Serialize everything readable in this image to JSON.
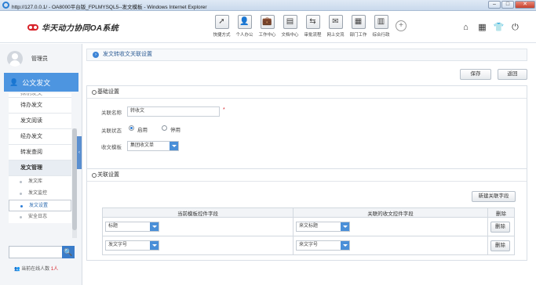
{
  "browser": {
    "title": "http://127.0.0.1/ - OA8000平台版_FPLMYSQL5--发文模板 - Windows Internet Explorer",
    "minimize": "–",
    "maximize": "□",
    "close": "✕"
  },
  "app": {
    "logo_text": "华天动力协同OA系统"
  },
  "topnav": [
    {
      "label": "快捷方式",
      "icon": "arrow-cursor-icon",
      "glyph": "➚"
    },
    {
      "label": "个人办公",
      "icon": "person-icon",
      "glyph": "👤"
    },
    {
      "label": "工作中心",
      "icon": "briefcase-icon",
      "glyph": "💼"
    },
    {
      "label": "文档中心",
      "icon": "folder-icon",
      "glyph": "▤"
    },
    {
      "label": "审批流程",
      "icon": "flow-icon",
      "glyph": "⇆"
    },
    {
      "label": "网上交流",
      "icon": "chat-icon",
      "glyph": "✉"
    },
    {
      "label": "部门工作",
      "icon": "department-icon",
      "glyph": "▦"
    },
    {
      "label": "综合行政",
      "icon": "trash-admin-icon",
      "glyph": "▥"
    }
  ],
  "topnav_more": "+",
  "header_icons": [
    {
      "name": "home-icon",
      "glyph": "⌂"
    },
    {
      "name": "grid-icon",
      "glyph": "▦"
    },
    {
      "name": "shirt-icon",
      "glyph": "👕"
    },
    {
      "name": "power-icon",
      "glyph": "⏻"
    }
  ],
  "sidebar": {
    "user": "管理员",
    "module": "公文发文",
    "module_icon": "person-icon",
    "items": [
      {
        "label": "拟制发文",
        "state": "cut"
      },
      {
        "label": "待办发文",
        "state": "normal"
      },
      {
        "label": "发文阅读",
        "state": "normal"
      },
      {
        "label": "经办发文",
        "state": "normal"
      },
      {
        "label": "转发查阅",
        "state": "normal"
      },
      {
        "label": "发文管理",
        "state": "active"
      }
    ],
    "subitems": [
      {
        "label": "发文库",
        "selected": false
      },
      {
        "label": "发文监控",
        "selected": false
      },
      {
        "label": "发文设置",
        "selected": true
      },
      {
        "label": "安全日志",
        "selected": false
      }
    ],
    "collapse_glyph": "‹",
    "search_icon": "🔍",
    "online_text": "当前在线人数",
    "online_count": "1人"
  },
  "main": {
    "breadcrumb": "发文转收文关联设置",
    "save_label": "保存",
    "back_label": "返回",
    "basic": {
      "title": "基础设置",
      "name_label": "关联名称",
      "name_value": "转收文",
      "required_mark": "*",
      "status_label": "关联状态",
      "status_on": "启用",
      "status_off": "停用",
      "status_value": "启用",
      "template_label": "收文模板",
      "template_value": "集团收文单"
    },
    "relation": {
      "title": "关联设置",
      "add_label": "新建关联字段",
      "columns": [
        "当前模板控件字段",
        "关联的收文控件字段",
        "删除"
      ],
      "rows": [
        {
          "source": "标题",
          "target": "来文标题",
          "delete": "删除"
        },
        {
          "source": "发文字号",
          "target": "来文字号",
          "delete": "删除"
        }
      ]
    }
  }
}
